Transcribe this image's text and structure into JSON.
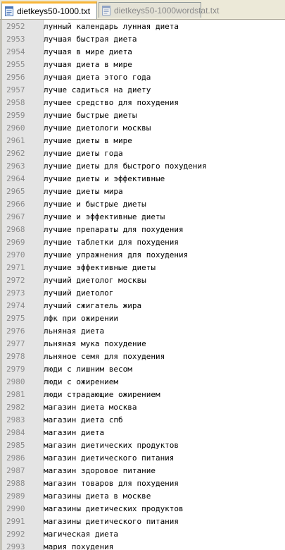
{
  "tabs": [
    {
      "label": "dietkeys50-1000.txt",
      "active": true,
      "icon": "text-file-icon"
    },
    {
      "label": "dietkeys50-1000wordstat.txt",
      "active": false,
      "icon": "text-file-icon"
    }
  ],
  "editor": {
    "lines": [
      {
        "num": "2952",
        "text": "лунный календарь лунная диета"
      },
      {
        "num": "2953",
        "text": "лучшая быстрая диета"
      },
      {
        "num": "2954",
        "text": "лучшая в мире диета"
      },
      {
        "num": "2955",
        "text": "лучшая диета в мире"
      },
      {
        "num": "2956",
        "text": "лучшая диета этого года"
      },
      {
        "num": "2957",
        "text": "лучше садиться на диету"
      },
      {
        "num": "2958",
        "text": "лучшее средство для похудения"
      },
      {
        "num": "2959",
        "text": "лучшие быстрые диеты"
      },
      {
        "num": "2960",
        "text": "лучшие диетологи москвы"
      },
      {
        "num": "2961",
        "text": "лучшие диеты в мире"
      },
      {
        "num": "2962",
        "text": "лучшие диеты года"
      },
      {
        "num": "2963",
        "text": "лучшие диеты для быстрого похудения"
      },
      {
        "num": "2964",
        "text": "лучшие диеты и эффективные"
      },
      {
        "num": "2965",
        "text": "лучшие диеты мира"
      },
      {
        "num": "2966",
        "text": "лучшие и быстрые диеты"
      },
      {
        "num": "2967",
        "text": "лучшие и эффективные диеты"
      },
      {
        "num": "2968",
        "text": "лучшие препараты для похудения"
      },
      {
        "num": "2969",
        "text": "лучшие таблетки для похудения"
      },
      {
        "num": "2970",
        "text": "лучшие упражнения для похудения"
      },
      {
        "num": "2971",
        "text": "лучшие эффективные диеты"
      },
      {
        "num": "2972",
        "text": "лучший диетолог москвы"
      },
      {
        "num": "2973",
        "text": "лучший диетолог"
      },
      {
        "num": "2974",
        "text": "лучший сжигатель жира"
      },
      {
        "num": "2975",
        "text": "лфк при ожирении"
      },
      {
        "num": "2976",
        "text": "льняная диета"
      },
      {
        "num": "2977",
        "text": "льняная мука похудение"
      },
      {
        "num": "2978",
        "text": "льняное семя для похудения"
      },
      {
        "num": "2979",
        "text": "люди с лишним весом"
      },
      {
        "num": "2980",
        "text": "люди с ожирением"
      },
      {
        "num": "2981",
        "text": "люди страдающие ожирением"
      },
      {
        "num": "2982",
        "text": "магазин диета москва"
      },
      {
        "num": "2983",
        "text": "магазин диета спб"
      },
      {
        "num": "2984",
        "text": "магазин диета"
      },
      {
        "num": "2985",
        "text": "магазин диетических продуктов"
      },
      {
        "num": "2986",
        "text": "магазин диетического питания"
      },
      {
        "num": "2987",
        "text": "магазин здоровое питание"
      },
      {
        "num": "2988",
        "text": "магазин товаров для похудения"
      },
      {
        "num": "2989",
        "text": "магазины диета в москве"
      },
      {
        "num": "2990",
        "text": "магазины диетических продуктов"
      },
      {
        "num": "2991",
        "text": "магазины диетического питания"
      },
      {
        "num": "2992",
        "text": "магическая диета"
      },
      {
        "num": "2993",
        "text": "мария похудения"
      }
    ]
  }
}
